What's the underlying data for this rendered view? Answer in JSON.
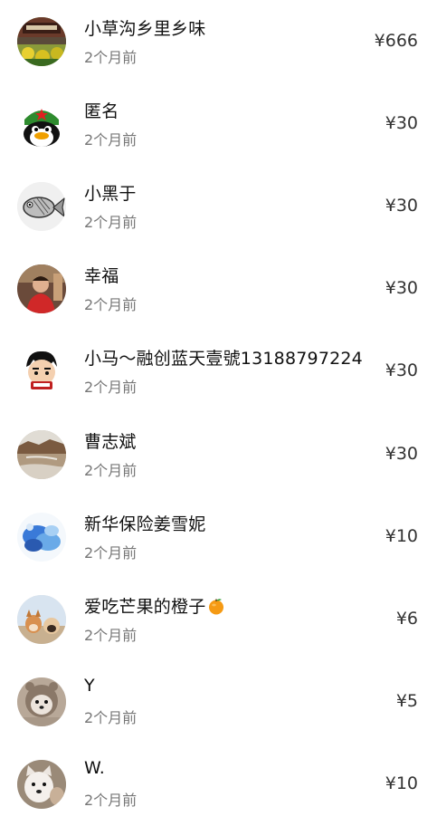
{
  "donations": [
    {
      "name": "小草沟乡里乡味",
      "time": "2个月前",
      "amount": "¥666",
      "avatar": "landscape-gate-avatar"
    },
    {
      "name": "匿名",
      "time": "2个月前",
      "amount": "¥30",
      "avatar": "qq-penguin-avatar"
    },
    {
      "name": "小黑于",
      "time": "2个月前",
      "amount": "¥30",
      "avatar": "sketch-fish-avatar"
    },
    {
      "name": "幸福",
      "time": "2个月前",
      "amount": "¥30",
      "avatar": "person-photo-avatar"
    },
    {
      "name": "小马～融创蓝天壹號13188797224",
      "time": "2个月前",
      "amount": "¥30",
      "avatar": "cartoon-boy-avatar"
    },
    {
      "name": "曹志斌",
      "time": "2个月前",
      "amount": "¥30",
      "avatar": "river-landscape-avatar"
    },
    {
      "name": "新华保险姜雪妮",
      "time": "2个月前",
      "amount": "¥10",
      "avatar": "blue-abstract-avatar"
    },
    {
      "name": "爱吃芒果的橙子",
      "time": "2个月前",
      "amount": "¥6",
      "avatar": "dogs-photo-avatar",
      "emoji": "orange-icon"
    },
    {
      "name": "Y",
      "time": "2个月前",
      "amount": "¥5",
      "avatar": "hooded-pet-avatar"
    },
    {
      "name": "W.",
      "time": "2个月前",
      "amount": "¥10",
      "avatar": "white-dog-avatar"
    }
  ]
}
